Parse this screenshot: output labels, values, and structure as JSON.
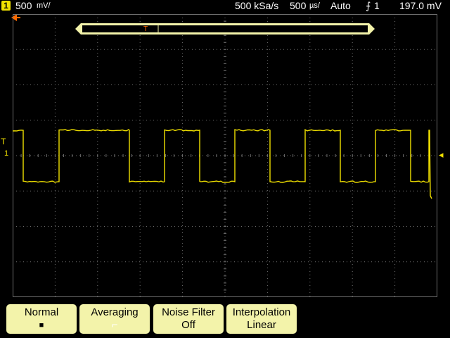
{
  "status": {
    "channel_number": "1",
    "vertical_scale": "500",
    "vertical_unit": "mV/",
    "sample_rate": "500 kSa/s",
    "timebase": "500",
    "timebase_unit": "µs/",
    "trigger_mode": "Auto",
    "trigger_source": "1",
    "trigger_level": "197.0 mV"
  },
  "timebase_window": {
    "trigger_label": "T"
  },
  "markers": {
    "trigger_left": "T",
    "ground_left": "1",
    "trigger_level_right": "◂"
  },
  "colors": {
    "trace": "#f0e000",
    "grid": "#6e6e6e",
    "softkey_bg": "#f3f3aa",
    "trigger_marker": "#ff6a00"
  },
  "softkeys": [
    {
      "title": "Normal",
      "value": "■"
    },
    {
      "title": "Averaging",
      "value": "⌐"
    },
    {
      "title": "Noise Filter",
      "value": "Off"
    },
    {
      "title": "Interpolation",
      "value": "Linear"
    }
  ]
}
